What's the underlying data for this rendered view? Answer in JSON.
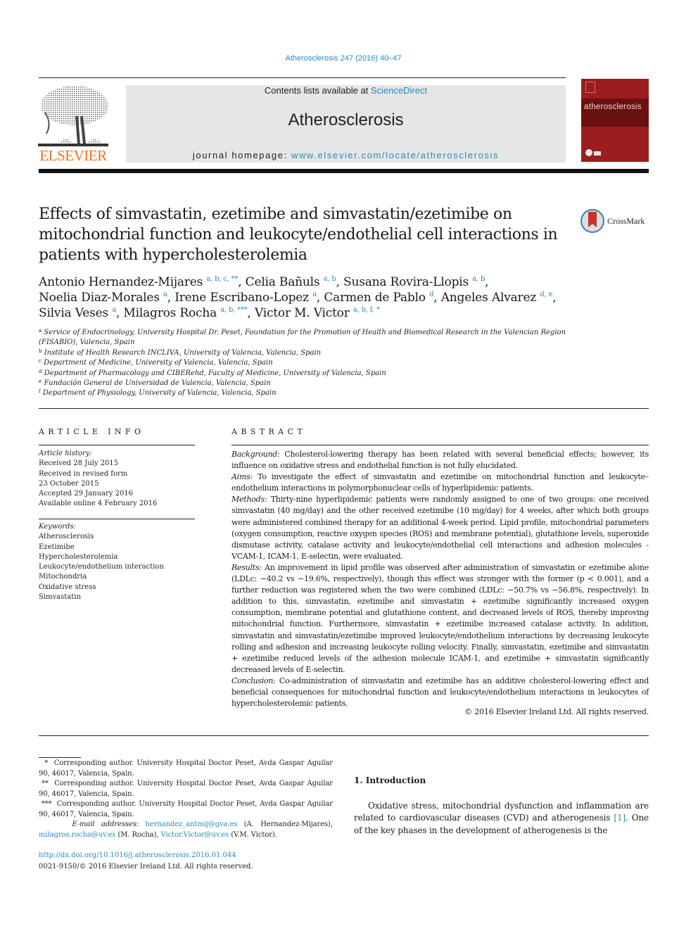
{
  "header": {
    "citation": "Atherosclerosis 247 (2016) 40–47",
    "contents_prefix": "Contents lists available at ",
    "contents_link": "ScienceDirect",
    "journal_name": "Atherosclerosis",
    "homepage_prefix": "journal homepage: ",
    "homepage_link": "www.elsevier.com/locate/atherosclerosis",
    "publisher_logo_text": "ELSEVIER",
    "cover_title": "atherosclerosis",
    "crossmark_label": "CrossMark",
    "colors": {
      "link": "#2a8ab8",
      "elsevier_orange": "#e8731c",
      "cover_red": "#9b1d1d",
      "masthead_gray": "#e6e6e6"
    }
  },
  "article": {
    "title": "Effects of simvastatin, ezetimibe and simvastatin/ezetimibe on mitochondrial function and leukocyte/endothelial cell interactions in patients with hypercholesterolemia",
    "authors": [
      {
        "name": "Antonio Hernandez-Mijares",
        "affil": "a, b, c, **",
        "sep": ", "
      },
      {
        "name": "Celia Bañuls",
        "affil": "a, b",
        "sep": ", "
      },
      {
        "name": "Susana Rovira-Llopis",
        "affil": "a, b",
        "sep": ","
      },
      {
        "name": "Noelia Diaz-Morales",
        "affil": "a",
        "sep": ", "
      },
      {
        "name": "Irene Escribano-Lopez",
        "affil": "a",
        "sep": ", "
      },
      {
        "name": "Carmen de Pablo",
        "affil": "d",
        "sep": ", "
      },
      {
        "name": "Angeles Alvarez",
        "affil": "d, e",
        "sep": ","
      },
      {
        "name": "Silvia Veses",
        "affil": "a",
        "sep": ", "
      },
      {
        "name": "Milagros Rocha",
        "affil": "a, b, ***",
        "sep": ", "
      },
      {
        "name": "Victor M. Victor",
        "affil": "a, b, f, *",
        "sep": ""
      }
    ],
    "affiliations": [
      {
        "key": "a",
        "text": "Service of Endocrinology, University Hospital Dr. Peset, Foundation for the Promotion of Health and Biomedical Research in the Valencian Region (FISABIO), Valencia, Spain"
      },
      {
        "key": "b",
        "text": "Institute of Health Research INCLIVA, University of Valencia, Valencia, Spain"
      },
      {
        "key": "c",
        "text": "Department of Medicine, University of Valencia, Valencia, Spain"
      },
      {
        "key": "d",
        "text": "Department of Pharmacology and CIBERehd, Faculty of Medicine, University of Valencia, Spain"
      },
      {
        "key": "e",
        "text": "Fundación General de Universidad de Valencia, Valencia, Spain"
      },
      {
        "key": "f",
        "text": "Department of Physiology, University of Valencia, Valencia, Spain"
      }
    ]
  },
  "article_info": {
    "heading": "ARTICLE INFO",
    "history_label": "Article history:",
    "history": [
      "Received 28 July 2015",
      "Received in revised form",
      "23 October 2015",
      "Accepted 29 January 2016",
      "Available online 4 February 2016"
    ],
    "keywords_label": "Keywords:",
    "keywords": [
      "Atherosclerosis",
      "Ezetimibe",
      "Hypercholesterolemia",
      "Leukocyte/endothelium interaction",
      "Mitochondria",
      "Oxidative stress",
      "Simvastatin"
    ]
  },
  "abstract": {
    "heading": "ABSTRACT",
    "sections": [
      {
        "label": "Background:",
        "text": "Cholesterol-lowering therapy has been related with several beneficial effects; however, its influence on oxidative stress and endothelial function is not fully elucidated."
      },
      {
        "label": "Aims:",
        "text": "To investigate the effect of simvastatin and ezetimibe on mitochondrial function and leukocyte–endothelium interactions in polymorphonuclear cells of hyperlipidemic patients."
      },
      {
        "label": "Methods:",
        "text": "Thirty-nine hyperlipidemic patients were randomly assigned to one of two groups: one received simvastatin (40 mg/day) and the other received ezetimibe (10 mg/day) for 4 weeks, after which both groups were administered combined therapy for an additional 4-week period. Lipid profile, mito­chondrial parameters (oxygen consumption, reactive oxygen species (ROS) and membrane potential), glutathione levels, superoxide dismutase activity, catalase activity and leukocyte/endothelial cell in­teractions and adhesion molecules -VCAM-1, ICAM-1, E-selectin, were evaluated."
      },
      {
        "label": "Results:",
        "text": "An improvement in lipid profile was observed after administration of simvastatin or ezetimibe alone (LDLc: −40.2 vs −19.6%, respectively), though this effect was stronger with the former (p < 0.001), and a further reduction was registered when the two were combined (LDLc: −50.7% vs −56.8%, respectively). In addition to this, simvastatin, ezetimibe and simvastatin + ezetimibe significantly increased oxygen consumption, membrane potential and glutathione content, and decreased levels of ROS, thereby improving mitochondrial function. Furthermore, simvastatin + ezetimibe increased cata­lase activity. In addition, simvastatin and simvastatin/ezetimibe improved leukocyte/endothelium in­teractions by decreasing leukocyte rolling and adhesion and increasing leukocyte rolling velocity. Finally, simvastatin, ezetimibe and simvastatin + ezetimibe reduced levels of the adhesion molecule ICAM-1, and ezetimibe + simvastatin significantly decreased levels of E-selectin."
      },
      {
        "label": "Conclusion:",
        "text": "Co-administration of simvastatin and ezetimibe has an additive cholesterol-lowering effect and beneficial consequences for mitochondrial function and leukocyte/endothelium interactions in leukocytes of hypercholesterolemic patients."
      }
    ],
    "copyright": "© 2016 Elsevier Ireland Ltd. All rights reserved."
  },
  "footnotes": {
    "corresponding": [
      {
        "mark": "*",
        "text": "Corresponding author. University Hospital Doctor Peset, Avda Gaspar Aguilar 90, 46017, Valencia, Spain."
      },
      {
        "mark": "**",
        "text": "Corresponding author. University Hospital Doctor Peset, Avda Gaspar Aguilar 90, 46017, Valencia, Spain."
      },
      {
        "mark": "***",
        "text": "Corresponding author. University Hospital Doctor Peset, Avda Gaspar Aguilar 90, 46017, Valencia, Spain."
      }
    ],
    "email_label": "E-mail addresses:",
    "emails": [
      {
        "address": "hernandez_antmij@gva.es",
        "owner": "(A. Hernandez-Mijares)",
        "sep": ", "
      },
      {
        "address": "milagros.rocha@uv.es",
        "owner": "(M. Rocha)",
        "sep": ", "
      },
      {
        "address": "Victor.Victor@uv.es",
        "owner": "(V.M. Victor)",
        "sep": "."
      }
    ],
    "doi": "http://dx.doi.org/10.1016/j.atherosclerosis.2016.01.044",
    "issn": "0021-9150/© 2016 Elsevier Ireland Ltd. All rights reserved."
  },
  "introduction": {
    "heading": "1.  Introduction",
    "text_before_ref": "Oxidative stress, mitochondrial dysfunction and inflammation are related to cardiovascular diseases (CVD) and atherogenesis ",
    "ref": "[1]",
    "text_after_ref": ". One of the key phases in the development of atherogenesis is the"
  }
}
